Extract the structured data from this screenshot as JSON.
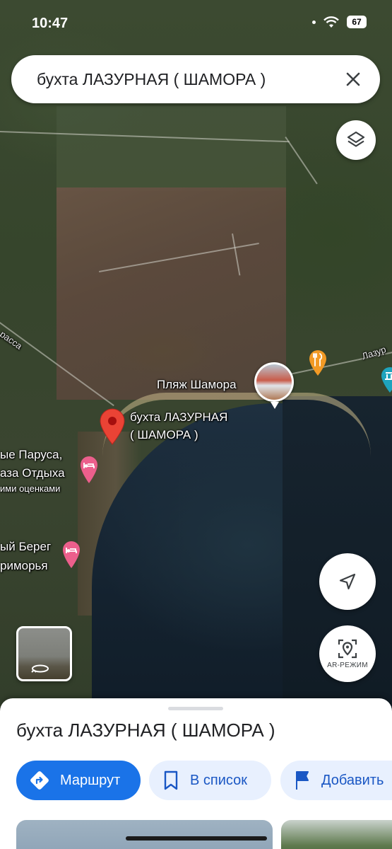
{
  "status_bar": {
    "time": "10:47",
    "battery": "67"
  },
  "search": {
    "query": "бухта ЛАЗУРНАЯ ( ШАМОРА )"
  },
  "map": {
    "labels": {
      "beach": "Пляж Шамора",
      "place_line1": "бухта ЛАЗУРНАЯ",
      "place_line2": "( ШАМОРА )",
      "hotel1_line1": "ые Паруса,",
      "hotel1_line2": "аза Отдыха",
      "hotel1_line3": "ими оценками",
      "hotel2_line1": "ый Берег",
      "hotel2_line2": "риморья",
      "road_left": "расса",
      "road_right": "Лазур"
    },
    "colors": {
      "place_pin": "#ea4335",
      "hotel_pin": "#ec5f8c",
      "food_pin": "#f29a25",
      "attraction_pin": "#1ea3bd"
    }
  },
  "controls": {
    "ar_label": "AR-РЕЖИМ"
  },
  "sheet": {
    "title": "бухта ЛАЗУРНАЯ ( ШАМОРА )",
    "buttons": {
      "route": "Маршрут",
      "save": "В список",
      "add": "Добавить"
    }
  }
}
